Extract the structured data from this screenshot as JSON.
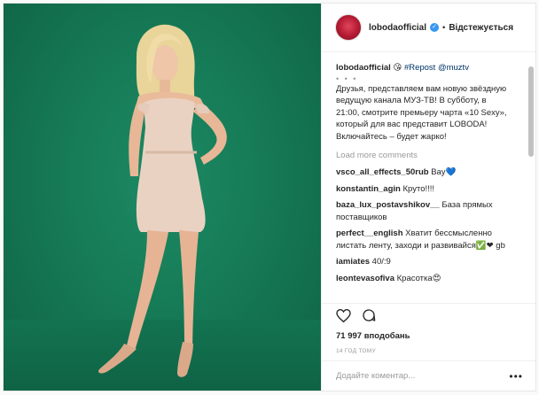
{
  "header": {
    "username": "lobodaofficial",
    "dot": "•",
    "follow_label": "Відстежується"
  },
  "caption": {
    "username": "lobodaofficial",
    "tag": "#Repost @muztv",
    "dots": "• • •",
    "text": "Друзья, представляем вам новую звёздную ведущую канала МУЗ-ТВ! В субботу, в 21:00, смотрите премьеру чарта «10 Sexy», который для вас представит LOBODA! Включайтесь – будет жарко!"
  },
  "load_more": "Load more comments",
  "comments": [
    {
      "user": "vsco_all_effects_50rub",
      "text": "Вау💙"
    },
    {
      "user": "konstantin_agin",
      "text": "Круто!!!!"
    },
    {
      "user": "baza_lux_postavshikov__",
      "text": "База прямых поставщиков"
    },
    {
      "user": "perfect__english",
      "text": "Хватит бессмысленно листать ленту, заходи и развивайся✅❤ gb"
    },
    {
      "user": "iamiates",
      "text": "40/:9"
    },
    {
      "user": "leontevasofiva",
      "text": "Красотка😍"
    }
  ],
  "likes": "71 997 вподобань",
  "time": "14 ГОД ТОМУ",
  "add_comment_placeholder": "Додайте коментар...",
  "icons": [
    "heart-icon",
    "comment-icon",
    "more-icon",
    "verified-icon"
  ],
  "colors": {
    "accent": "#3897f0",
    "background": "#fafafa",
    "photo_bg": "#167a56"
  }
}
